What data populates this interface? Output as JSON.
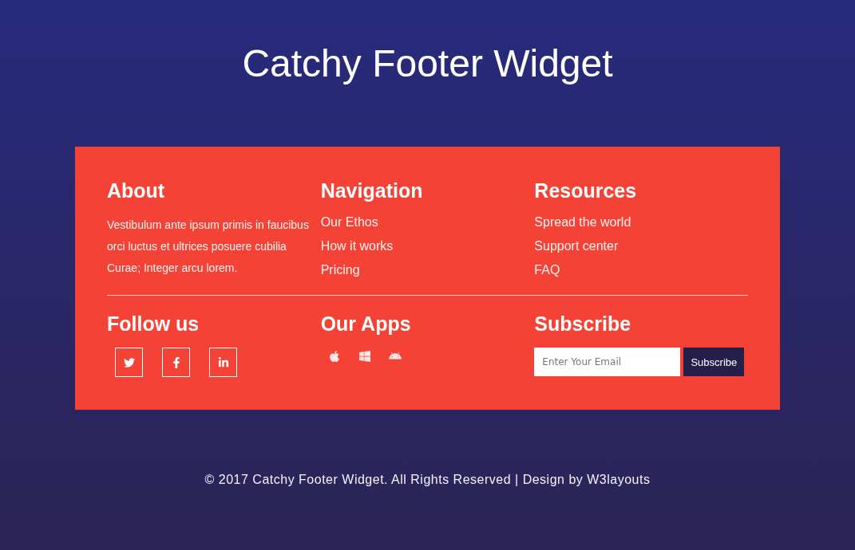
{
  "page_title": "Catchy Footer Widget",
  "footer_widget": {
    "rows": [
      {
        "sections": [
          {
            "kind": "text",
            "heading": "About",
            "text": "Vestibulum ante ipsum primis in faucibus orci luctus et ultrices posuere cubilia Curae; Integer arcu lorem."
          },
          {
            "kind": "links",
            "heading": "Navigation",
            "links": [
              "Our Ethos",
              "How it works",
              "Pricing"
            ]
          },
          {
            "kind": "links",
            "heading": "Resources",
            "links": [
              "Spread the world",
              "Support center",
              "FAQ"
            ]
          }
        ]
      },
      {
        "sections": [
          {
            "kind": "social",
            "heading": "Follow us",
            "items": [
              {
                "kind": "twitter"
              },
              {
                "kind": "facebook"
              },
              {
                "kind": "linkedin"
              }
            ]
          },
          {
            "kind": "apps",
            "heading": "Our Apps",
            "items": [
              {
                "kind": "apple"
              },
              {
                "kind": "windows"
              },
              {
                "kind": "android"
              }
            ]
          },
          {
            "kind": "subscribe",
            "heading": "Subscribe",
            "placeholder": "Enter Your Email",
            "button": "Subscribe"
          }
        ]
      }
    ]
  },
  "copyright": "© 2017 Catchy Footer Widget. All Rights Reserved | Design by W3layouts"
}
